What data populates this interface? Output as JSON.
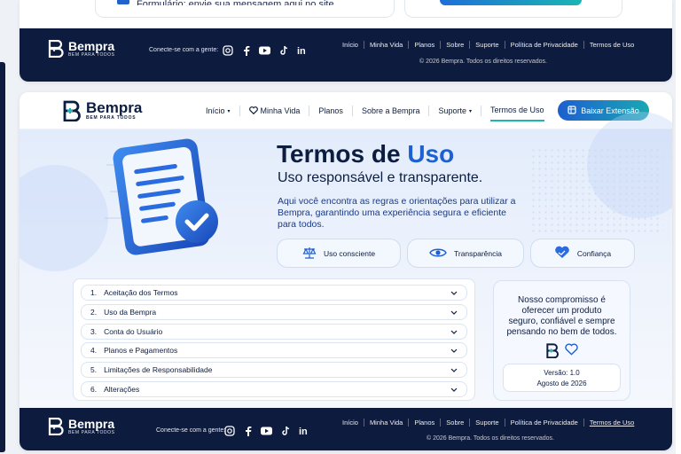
{
  "brand": {
    "name": "Bempra",
    "tagline": "BEM PARA TODOS"
  },
  "top_card": {
    "ghost_text": "Formulário: envie sua mensagem aqui no site"
  },
  "header": {
    "nav": [
      {
        "label": "Início",
        "caret": "▾"
      },
      {
        "label": "Minha Vida"
      },
      {
        "label": "Planos"
      },
      {
        "label": "Sobre a Bempra"
      },
      {
        "label": "Suporte",
        "caret": "▾"
      },
      {
        "label": "Termos de Uso"
      }
    ],
    "cta": "Baixar Extensão"
  },
  "hero": {
    "title_a": "Termos de ",
    "title_b": "Uso",
    "subtitle": "Uso responsável e transparente.",
    "description": "Aqui você encontra as regras e orientações para utilizar a Bempra, garantindo uma experiência segura e eficiente para todos.",
    "pills": [
      "Uso consciente",
      "Transparência",
      "Confiança"
    ]
  },
  "sections": [
    {
      "num": "1.",
      "label": "Aceitação dos Termos"
    },
    {
      "num": "2.",
      "label": "Uso da Bempra"
    },
    {
      "num": "3.",
      "label": "Conta do Usuário"
    },
    {
      "num": "4.",
      "label": "Planos e Pagamentos"
    },
    {
      "num": "5.",
      "label": "Limitações de Responsabilidade"
    },
    {
      "num": "6.",
      "label": "Alterações"
    }
  ],
  "commitment": {
    "text": "Nosso compromisso é oferecer um produto seguro, confiável e sempre pensando no bem de todos.",
    "version": "Versão: 1.0",
    "date": "Agosto de 2026"
  },
  "footer": {
    "follow": "Conecte-se com a gente:",
    "links": [
      "Início",
      "Minha Vida",
      "Planos",
      "Sobre",
      "Suporte",
      "Política de Privacidade",
      "Termos de Uso"
    ],
    "copyright": "© 2026 Bempra. Todos os direitos reservados."
  },
  "colors": {
    "navy": "#0d1b3f",
    "accent": "#1e5fd1",
    "teal": "#1bb6b4"
  }
}
